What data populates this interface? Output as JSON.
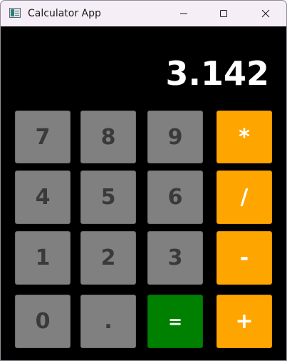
{
  "window": {
    "title": "Calculator App"
  },
  "display": {
    "value": "3.142"
  },
  "keys": {
    "k7": "7",
    "k8": "8",
    "k9": "9",
    "mul": "*",
    "k4": "4",
    "k5": "5",
    "k6": "6",
    "div": "/",
    "k1": "1",
    "k2": "2",
    "k3": "3",
    "sub": "-",
    "k0": "0",
    "dot": ".",
    "eq": "=",
    "add": "+"
  },
  "colors": {
    "digit_key": "#808080",
    "operator_key": "#ffa500",
    "equals_key": "#008000",
    "background": "#000000"
  }
}
